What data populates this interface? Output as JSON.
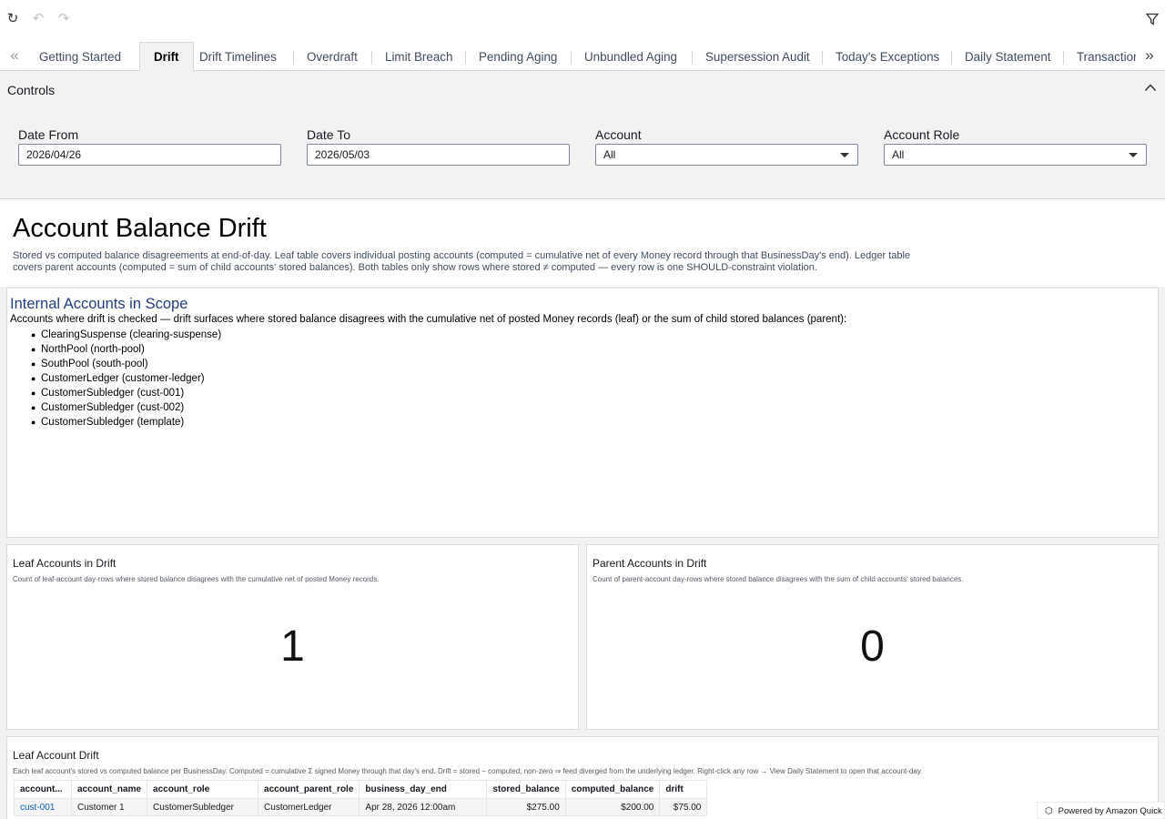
{
  "topbar": {
    "icons": [
      "refresh-icon",
      "undo-icon",
      "redo-icon",
      "filter-icon"
    ]
  },
  "tabs": [
    {
      "label": "Getting Started",
      "active": false
    },
    {
      "label": "Drift",
      "active": true
    },
    {
      "label": "Drift Timelines",
      "active": false
    },
    {
      "label": "Overdraft",
      "active": false
    },
    {
      "label": "Limit Breach",
      "active": false
    },
    {
      "label": "Pending Aging",
      "active": false
    },
    {
      "label": "Unbundled Aging",
      "active": false
    },
    {
      "label": "Supersession Audit",
      "active": false
    },
    {
      "label": "Today's Exceptions",
      "active": false
    },
    {
      "label": "Daily Statement",
      "active": false
    },
    {
      "label": "Transactions",
      "active": false
    }
  ],
  "controls": {
    "title": "Controls",
    "date_from": {
      "label": "Date From",
      "value": "2026/04/26"
    },
    "date_to": {
      "label": "Date To",
      "value": "2026/05/03"
    },
    "account": {
      "label": "Account",
      "value": "All"
    },
    "account_role": {
      "label": "Account Role",
      "value": "All"
    }
  },
  "header": {
    "title": "Account Balance Drift",
    "description": "Stored vs computed balance disagreements at end-of-day. Leaf table covers individual posting accounts (computed = cumulative net of every Money record through that BusinessDay's end). Ledger table covers parent accounts (computed = sum of child accounts' stored balances). Both tables only show rows where stored ≠ computed — every row is one SHOULD-constraint violation."
  },
  "scope": {
    "title": "Internal Accounts in Scope",
    "intro": "Accounts where drift is checked — drift surfaces where stored balance disagrees with the cumulative net of posted Money records (leaf) or the sum of child stored balances (parent):",
    "items": [
      "ClearingSuspense (clearing-suspense)",
      "NorthPool (north-pool)",
      "SouthPool (south-pool)",
      "CustomerLedger (customer-ledger)",
      "CustomerSubledger (cust-001)",
      "CustomerSubledger (cust-002)",
      "CustomerSubledger (template)"
    ]
  },
  "kpis": {
    "leaf": {
      "title": "Leaf Accounts in Drift",
      "subtitle": "Count of leaf-account day-rows where stored balance disagrees with the cumulative net of posted Money records.",
      "value": "1"
    },
    "parent": {
      "title": "Parent Accounts in Drift",
      "subtitle": "Count of parent-account day-rows where stored balance disagrees with the sum of child accounts' stored balances.",
      "value": "0"
    }
  },
  "leaf_table": {
    "title": "Leaf Account Drift",
    "subtitle": "Each leaf account's stored vs computed balance per BusinessDay. Computed = cumulative Σ signed Money through that day's end. Drift = stored − computed; non-zero ⇒ feed diverged from the underlying ledger. Right-click any row → View Daily Statement to open that account-day.",
    "columns": [
      "account...",
      "account_name",
      "account_role",
      "account_parent_role",
      "business_day_end",
      "stored_balance",
      "computed_balance",
      "drift"
    ],
    "rows": [
      [
        "cust-001",
        "Customer 1",
        "CustomerSubledger",
        "CustomerLedger",
        "Apr 28, 2026 12:00am",
        "$275.00",
        "$200.00",
        "$75.00"
      ]
    ]
  },
  "footer": {
    "powered_by": "Powered by Amazon Quick"
  }
}
